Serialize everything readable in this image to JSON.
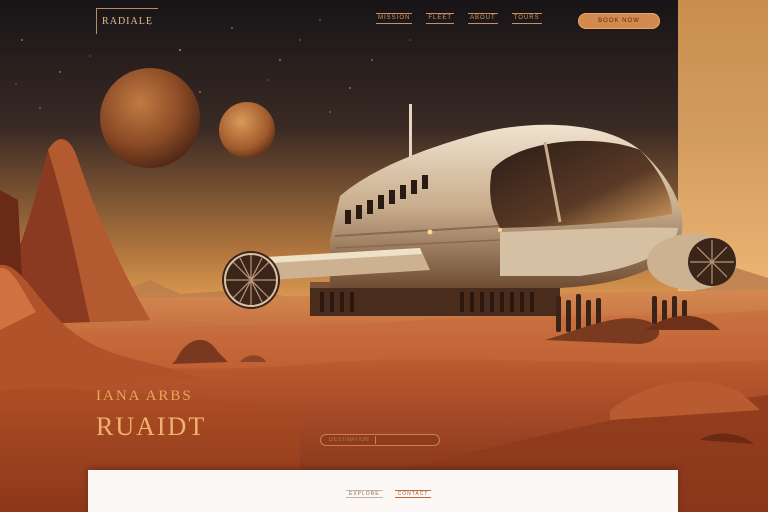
{
  "nav": {
    "logo_text": "RADIALE",
    "links": [
      "MISSION",
      "FLEET",
      "ABOUT",
      "TOURS"
    ],
    "cta_label": "BOOK NOW"
  },
  "hero": {
    "kicker": "IANA ARBS",
    "title": "RUAIDT",
    "search_placeholder": "DESTINATION"
  },
  "footer": {
    "links": [
      "EXPLORE",
      "CONTACT"
    ]
  },
  "colors": {
    "sky_top": "#1c1718",
    "sky_glow": "#e9a75a",
    "dune": "#c56a38",
    "accent": "#d28a4e"
  },
  "icons": [
    "planet-large-icon",
    "planet-small-icon",
    "spaceship-icon",
    "antenna-icon"
  ]
}
